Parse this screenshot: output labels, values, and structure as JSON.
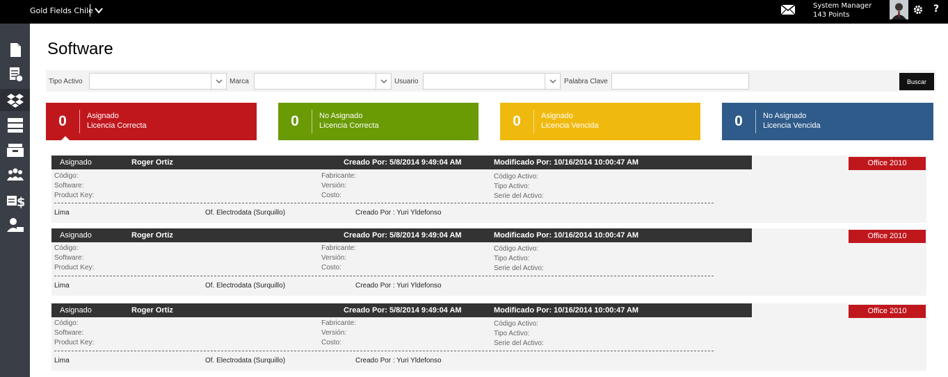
{
  "topbar": {
    "company": "Gold Fields Chile",
    "user_name": "System Manager",
    "user_points": "143 Points",
    "help": "?"
  },
  "sidebar": {
    "items": [
      {
        "icon": "document-icon",
        "active": false
      },
      {
        "icon": "invoice-icon",
        "active": false
      },
      {
        "icon": "dropbox-icon",
        "active": true
      },
      {
        "icon": "server-icon",
        "active": false
      },
      {
        "icon": "archive-icon",
        "active": false
      },
      {
        "icon": "users-icon",
        "active": false
      },
      {
        "icon": "money-icon",
        "active": false
      },
      {
        "icon": "user-desk-icon",
        "active": false
      }
    ]
  },
  "page": {
    "title": "Software"
  },
  "filters": {
    "tipo_activo_label": "Tipo Activo",
    "marca_label": "Marca",
    "usuario_label": "Usuario",
    "palabra_clave_label": "Palabra Clave",
    "buscar_label": "Buscar"
  },
  "tiles": [
    {
      "count": "0",
      "line1": "Asignado",
      "line2": "Licencia Correcta",
      "color": "#c0171d"
    },
    {
      "count": "0",
      "line1": "No Asignado",
      "line2": "Licencia Correcta",
      "color": "#6a9a04"
    },
    {
      "count": "0",
      "line1": "Asignado",
      "line2": "Licencia Vencida",
      "color": "#f0b90e"
    },
    {
      "count": "0",
      "line1": "No Asignado",
      "line2": "Licencia Vencida",
      "color": "#2f5b8a"
    }
  ],
  "records": [
    {
      "status": "Asignado",
      "user": "Roger Ortiz",
      "created": "Creado Por: 5/8/2014 9:49:04 AM",
      "modified": "Modificado Por: 10/16/2014 10:00:47 AM",
      "tag": "Office 2010",
      "codigo": "Código:",
      "software": "Software:",
      "product_key": "Product Key:",
      "fabricante": "Fabricante:",
      "version": "Versión:",
      "costo": "Costo:",
      "codigo_activo": "Código Activo:",
      "tipo_activo": "Tipo Activo:",
      "serie_activo": "Serie del Activo:",
      "location": "Lima",
      "office": "Of. Electrodata (Surquillo)",
      "creator": "Creado Por : Yuri Yldefonso"
    },
    {
      "status": "Asignado",
      "user": "Roger Ortiz",
      "created": "Creado Por: 5/8/2014 9:49:04 AM",
      "modified": "Modificado Por: 10/16/2014 10:00:47 AM",
      "tag": "Office 2010",
      "codigo": "Código:",
      "software": "Software:",
      "product_key": "Product Key:",
      "fabricante": "Fabricante:",
      "version": "Versión:",
      "costo": "Costo:",
      "codigo_activo": "Código Activo:",
      "tipo_activo": "Tipo Activo:",
      "serie_activo": "Serie del Activo:",
      "location": "Lima",
      "office": "Of. Electrodata (Surquillo)",
      "creator": "Creado Por : Yuri Yldefonso"
    },
    {
      "status": "Asignado",
      "user": "Roger Ortiz",
      "created": "Creado Por: 5/8/2014 9:49:04 AM",
      "modified": "Modificado Por: 10/16/2014 10:00:47 AM",
      "tag": "Office 2010",
      "codigo": "Código:",
      "software": "Software:",
      "product_key": "Product Key:",
      "fabricante": "Fabricante:",
      "version": "Versión:",
      "costo": "Costo:",
      "codigo_activo": "Código Activo:",
      "tipo_activo": "Tipo Activo:",
      "serie_activo": "Serie del Activo:",
      "location": "Lima",
      "office": "Of. Electrodata (Surquillo)",
      "creator": "Creado Por : Yuri Yldefonso"
    }
  ]
}
